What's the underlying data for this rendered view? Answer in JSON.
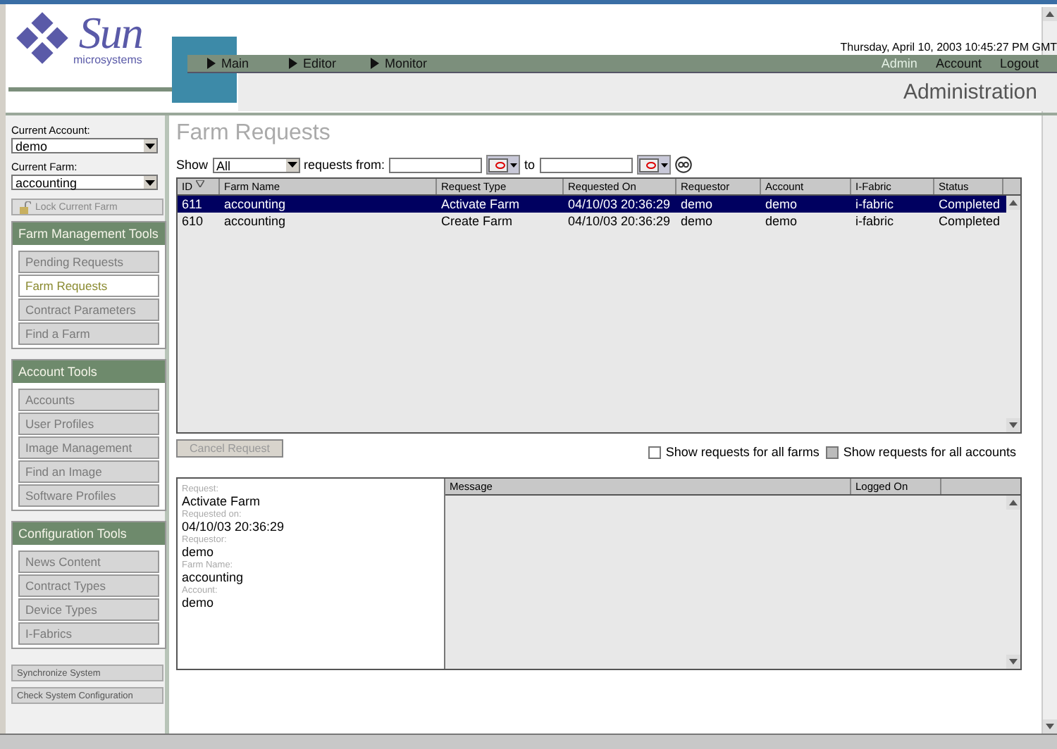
{
  "logo": {
    "brand": "Sun",
    "tagline": "microsystems"
  },
  "header": {
    "date": "Thursday, April 10, 2003 10:45:27 PM GMT",
    "nav_left": [
      {
        "label": "Main"
      },
      {
        "label": "Editor"
      },
      {
        "label": "Monitor"
      }
    ],
    "nav_right": [
      {
        "label": "Admin",
        "selected": true
      },
      {
        "label": "Account",
        "selected": false
      },
      {
        "label": "Logout",
        "selected": false
      }
    ],
    "section": "Administration"
  },
  "sidebar": {
    "account_label": "Current Account:",
    "account_value": "demo",
    "farm_label": "Current Farm:",
    "farm_value": "accounting",
    "lock_button": {
      "label": "Lock Current Farm",
      "disabled": true
    },
    "groups": [
      {
        "title": "Farm Management Tools",
        "items": [
          {
            "label": "Pending Requests",
            "selected": false
          },
          {
            "label": "Farm Requests",
            "selected": true
          },
          {
            "label": "Contract Parameters",
            "selected": false
          },
          {
            "label": "Find a Farm",
            "selected": false
          }
        ]
      },
      {
        "title": "Account Tools",
        "items": [
          {
            "label": "Accounts",
            "selected": false
          },
          {
            "label": "User Profiles",
            "selected": false
          },
          {
            "label": "Image Management",
            "selected": false
          },
          {
            "label": "Find an Image",
            "selected": false
          },
          {
            "label": "Software Profiles",
            "selected": false
          }
        ]
      },
      {
        "title": "Configuration Tools",
        "items": [
          {
            "label": "News Content",
            "selected": false
          },
          {
            "label": "Contract Types",
            "selected": false
          },
          {
            "label": "Device Types",
            "selected": false
          },
          {
            "label": "I-Fabrics",
            "selected": false
          }
        ]
      }
    ],
    "bottom_buttons": [
      "Synchronize System",
      "Check System Configuration"
    ]
  },
  "page": {
    "title": "Farm Requests",
    "filter": {
      "show_label": "Show",
      "show_value": "All",
      "from_label": "requests from:",
      "to_label": "to"
    },
    "table": {
      "columns": [
        "ID",
        "Farm Name",
        "Request Type",
        "Requested On",
        "Requestor",
        "Account",
        "I-Fabric",
        "Status"
      ],
      "rows": [
        {
          "selected": true,
          "cells": [
            "611",
            "accounting",
            "Activate Farm",
            "04/10/03 20:36:29",
            "demo",
            "demo",
            "i-fabric",
            "Completed"
          ]
        },
        {
          "selected": false,
          "cells": [
            "610",
            "accounting",
            "Create Farm",
            "04/10/03 20:36:29",
            "demo",
            "demo",
            "i-fabric",
            "Completed"
          ]
        }
      ]
    },
    "cancel_button": {
      "label": "Cancel Request",
      "disabled": true
    },
    "options": [
      {
        "label": "Show requests for all farms",
        "disabled": false
      },
      {
        "label": "Show requests for all accounts",
        "disabled": true
      }
    ],
    "details": [
      {
        "label": "Request:",
        "value": "Activate Farm"
      },
      {
        "label": "Requested on:",
        "value": "04/10/03 20:36:29"
      },
      {
        "label": "Requestor:",
        "value": "demo"
      },
      {
        "label": "Farm Name:",
        "value": "accounting"
      },
      {
        "label": "Account:",
        "value": "demo"
      }
    ],
    "log_columns": [
      "Message",
      "Logged On"
    ]
  }
}
